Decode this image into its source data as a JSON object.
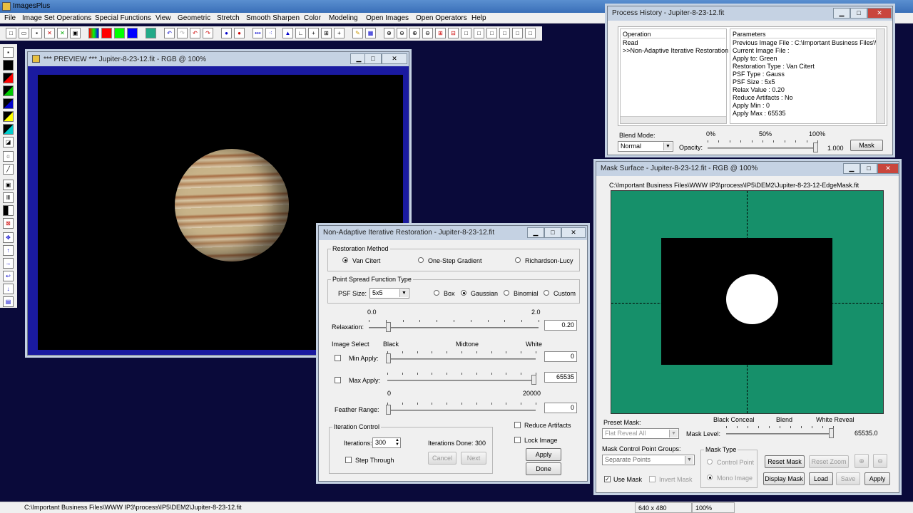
{
  "app": {
    "title": "ImagesPlus"
  },
  "menu": [
    "File",
    "Image Set Operations",
    "Special Functions",
    "View",
    "Geometric",
    "Stretch",
    "Smooth Sharpen",
    "Color",
    "Modeling",
    "Open Images",
    "Open Operators",
    "Help"
  ],
  "preview": {
    "title": "*** PREVIEW *** Jupiter-8-23-12.fit - RGB @ 100%"
  },
  "history": {
    "title": "Process History - Jupiter-8-23-12.fit",
    "col_operation": "Operation",
    "col_parameters": "Parameters",
    "operations": [
      "Read",
      ">>Non-Adaptive Iterative Restoration"
    ],
    "parameters": [
      "Previous Image File : C:\\Important Business Files\\WW",
      "Current Image File :",
      "Apply to:  Green",
      "Restoration Type : Van Citert",
      "PSF Type : Gauss",
      "PSF Size : 5x5",
      "Relax Value :  0.20",
      "Reduce Artifacts : No",
      "Apply Min : 0",
      "Apply Max : 65535"
    ],
    "blend_label": "Blend Mode:",
    "blend_value": "Normal",
    "opacity_label": "Opacity:",
    "op0": "0%",
    "op50": "50%",
    "op100": "100%",
    "opacity_value": "1.000",
    "mask_button": "Mask"
  },
  "restore": {
    "title": "Non-Adaptive Iterative Restoration - Jupiter-8-23-12.fit",
    "method_group": "Restoration Method",
    "m1": "Van Citert",
    "m2": "One-Step Gradient",
    "m3": "Richardson-Lucy",
    "psf_group": "Point Spread Function Type",
    "psf_size_label": "PSF Size:",
    "psf_size": "5x5",
    "p1": "Box",
    "p2": "Gaussian",
    "p3": "Binomial",
    "p4": "Custom",
    "relax_min": "0.0",
    "relax_max": "2.0",
    "relax_label": "Relaxation:",
    "relax_value": "0.20",
    "relax_level": 0.1,
    "image_select": "Image Select",
    "black": "Black",
    "midtone": "Midtone",
    "white": "White",
    "min_apply": "Min Apply:",
    "min_value": "0",
    "max_apply": "Max Apply:",
    "max_value": "65535",
    "feather_min": "0",
    "feather_max": "20000",
    "feather_label": "Feather Range:",
    "feather_value": "0",
    "iter_group": "Iteration Control",
    "iter_label": "Iterations:",
    "iter_value": "300",
    "iter_done": "Iterations Done:  300",
    "step_through": "Step Through",
    "cancel": "Cancel",
    "next": "Next",
    "reduce_artifacts": "Reduce Artifacts",
    "lock_image": "Lock Image",
    "apply": "Apply",
    "done": "Done"
  },
  "mask": {
    "title": "Mask Surface - Jupiter-8-23-12.fit - RGB @ 100%",
    "path": "C:\\Important Business Files\\WWW IP3\\process\\IP5\\DEM2\\Jupiter-8-23-12-EdgeMask.fit",
    "preset_label": "Preset Mask:",
    "preset_value": "Flat Reveal All",
    "black_conceal": "Black Conceal",
    "blend": "Blend",
    "white_reveal": "White Reveal",
    "mask_level_label": "Mask Level:",
    "mask_level_value": "65535.0",
    "groups_label": "Mask Control Point Groups:",
    "groups_value": "Separate Points",
    "type_group": "Mask Type",
    "control_point": "Control Point",
    "mono_image": "Mono Image",
    "reset_mask": "Reset Mask",
    "reset_zoom": "Reset Zoom",
    "use_mask": "Use Mask",
    "invert_mask": "Invert Mask",
    "display_mask": "Display Mask",
    "load": "Load",
    "save": "Save",
    "apply": "Apply"
  },
  "status": {
    "path": "C:\\Important Business Files\\WWW IP3\\process\\IP5\\DEM2\\Jupiter-8-23-12.fit",
    "size": "640 x 480",
    "zoom": "100%"
  },
  "colors": {
    "mask_bg": "#16906a",
    "desk": "#0c0c40",
    "preview_frame": "#1a1aa0"
  }
}
